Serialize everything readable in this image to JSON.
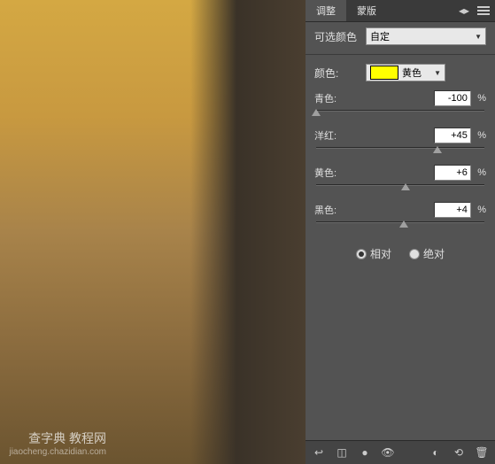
{
  "tabs": {
    "adjustments": "调整",
    "masks": "蒙版"
  },
  "selective_color": {
    "title_label": "可选颜色",
    "preset": "自定",
    "color_label": "颜色:",
    "color_name": "黄色",
    "color_swatch": "#ffff00"
  },
  "sliders": {
    "cyan": {
      "label": "青色:",
      "value": "-100",
      "pos": 0
    },
    "magenta": {
      "label": "洋红:",
      "value": "+45",
      "pos": 72
    },
    "yellow": {
      "label": "黄色:",
      "value": "+6",
      "pos": 53
    },
    "black": {
      "label": "黑色:",
      "value": "+4",
      "pos": 52
    }
  },
  "method": {
    "relative": "相对",
    "absolute": "绝对",
    "selected": "relative"
  },
  "watermark": {
    "main": "查字典 教程网",
    "sub": "jiaocheng.chazidian.com"
  },
  "percent_sign": "%"
}
